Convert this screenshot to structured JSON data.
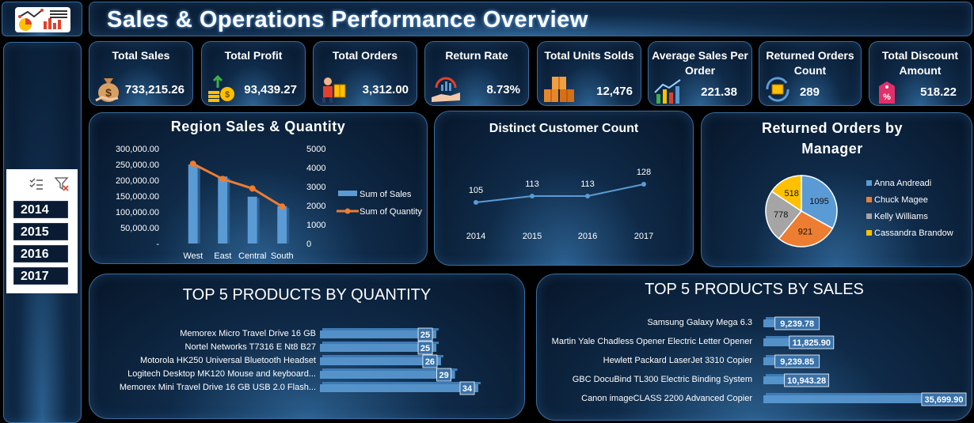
{
  "header": {
    "title": "Sales & Operations Performance Overview"
  },
  "slicer": {
    "years": [
      "2014",
      "2015",
      "2016",
      "2017"
    ]
  },
  "kpis": [
    {
      "title": "Total Sales",
      "value": "733,215.26",
      "icon": "money-bag-icon"
    },
    {
      "title": "Total Profit",
      "value": "93,439.27",
      "icon": "profit-growth-icon"
    },
    {
      "title": "Total Orders",
      "value": "3,312.00",
      "icon": "delivery-person-icon"
    },
    {
      "title": "Return Rate",
      "value": "8.73%",
      "icon": "return-chart-hand-icon"
    },
    {
      "title": "Total Units Solds",
      "value": "12,476",
      "icon": "boxes-icon"
    },
    {
      "title": "Average Sales Per Order",
      "value": "221.38",
      "icon": "bar-chart-icon"
    },
    {
      "title": "Returned Orders Count",
      "value": "289",
      "icon": "return-box-icon"
    },
    {
      "title": "Total Discount Amount",
      "value": "518.22",
      "icon": "discount-tag-icon"
    }
  ],
  "colors": {
    "blue": "#5b9bd5",
    "orange": "#ed7d31",
    "gray": "#a5a5a5",
    "gold": "#ffc000"
  },
  "chart_data": [
    {
      "type": "bar",
      "title": "Region Sales & Quantity",
      "categories": [
        "West",
        "East",
        "Central",
        "South"
      ],
      "series": [
        {
          "name": "Sum of Sales",
          "values": [
            250000,
            212000,
            148000,
            118000
          ],
          "axis": "left"
        },
        {
          "name": "Sum of Quantity",
          "values": [
            4200,
            3400,
            2900,
            1950
          ],
          "axis": "right",
          "type": "line"
        }
      ],
      "ylim": [
        0,
        300000
      ],
      "yticks": [
        "-",
        "50,000.00",
        "100,000.00",
        "150,000.00",
        "200,000.00",
        "250,000.00",
        "300,000.00"
      ],
      "y2lim": [
        0,
        5000
      ],
      "y2ticks": [
        "0",
        "1000",
        "2000",
        "3000",
        "4000",
        "5000"
      ],
      "legend": "right"
    },
    {
      "type": "line",
      "title": "Distinct Customer Count",
      "categories": [
        "2014",
        "2015",
        "2016",
        "2017"
      ],
      "values": [
        105,
        113,
        113,
        128
      ],
      "ylim": [
        60,
        180
      ]
    },
    {
      "type": "pie",
      "title": "Returned Orders by Manager",
      "series": [
        {
          "name": "Anna Andreadi",
          "value": 1095,
          "color": "#5b9bd5"
        },
        {
          "name": "Chuck Magee",
          "value": 921,
          "color": "#ed7d31"
        },
        {
          "name": "Kelly Williams",
          "value": 778,
          "color": "#a5a5a5"
        },
        {
          "name": "Cassandra Brandow",
          "value": 518,
          "color": "#ffc000"
        }
      ],
      "legend": "right"
    },
    {
      "type": "bar",
      "title": "TOP 5 PRODUCTS BY QUANTITY",
      "categories": [
        "Memorex Micro Travel Drive 16 GB",
        "Nortel Networks T7316 E Nt8 B27",
        "Motorola HK250 Universal Bluetooth Headset",
        "Logitech Desktop MK120 Mouse and keyboard...",
        "Memorex Mini Travel Drive 16 GB USB 2.0 Flash..."
      ],
      "values": [
        25,
        25,
        26,
        29,
        34
      ],
      "xlim": [
        0,
        34
      ]
    },
    {
      "type": "bar",
      "title": "TOP 5 PRODUCTS BY SALES",
      "categories": [
        "Samsung Galaxy Mega 6.3",
        "Martin Yale Chadless Opener Electric Letter Opener",
        "Hewlett Packard LaserJet 3310 Copier",
        "GBC DocuBind TL300 Electric Binding System",
        "Canon imageCLASS 2200 Advanced Copier"
      ],
      "values": [
        9239.78,
        11825.9,
        9239.85,
        10943.28,
        35699.9
      ],
      "labels": [
        "9,239.78",
        "11,825.90",
        "9,239.85",
        "10,943.28",
        "35,699.90"
      ],
      "xlim": [
        0,
        35699.9
      ]
    }
  ]
}
